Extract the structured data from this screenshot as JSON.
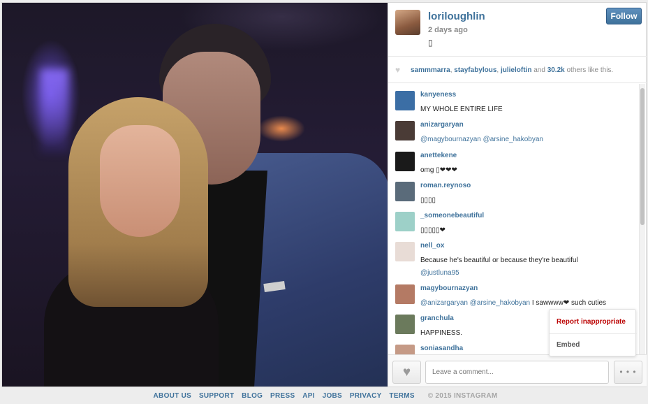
{
  "post": {
    "username": "loriloughlin",
    "time": "2 days ago",
    "caption": "▯",
    "follow_label": "Follow"
  },
  "likes": {
    "users": [
      "sammmarra",
      "stayfabylous",
      "julieloftin"
    ],
    "and_text": "and",
    "count": "30.2k",
    "suffix": "others like this."
  },
  "comments": [
    {
      "user": "kanyeness",
      "text": "MY WHOLE ENTIRE LIFE",
      "avatar_color": "#3b6ea5"
    },
    {
      "user": "anizargaryan",
      "mentions": "@magybournazyan @arsine_hakobyan",
      "avatar_color": "#4a3b36"
    },
    {
      "user": "anettekene",
      "text": "omg ▯❤❤❤",
      "avatar_color": "#1a1a1a"
    },
    {
      "user": "roman.reynoso",
      "text": "▯▯▯▯",
      "avatar_color": "#5a6b7a"
    },
    {
      "user": "_someonebeautiful",
      "text": "▯▯▯▯▯❤",
      "avatar_color": "#9dd0c8"
    },
    {
      "user": "nell_ox",
      "text": "Because he's beautiful or because they're beautiful",
      "mention": "@justluna95",
      "avatar_color": "#e8dcd6"
    },
    {
      "user": "magybournazyan",
      "mentions": "@anizargaryan @arsine_hakobyan",
      "text": " I sawwww❤ such cuties",
      "avatar_color": "#b47a64"
    },
    {
      "user": "granchula",
      "text": "HAPPINESS.",
      "avatar_color": "#6b7a5c"
    },
    {
      "user": "soniasandha",
      "text": "",
      "avatar_color": "#c59a86"
    }
  ],
  "input": {
    "placeholder": "Leave a comment...",
    "more_label": "• • •"
  },
  "menu": {
    "report": "Report inappropriate",
    "embed": "Embed"
  },
  "footer": {
    "links": [
      "ABOUT US",
      "SUPPORT",
      "BLOG",
      "PRESS",
      "API",
      "JOBS",
      "PRIVACY",
      "TERMS"
    ],
    "copyright": "© 2015 INSTAGRAM"
  },
  "colors": {
    "link": "#3f729b",
    "report": "#bb0000"
  }
}
